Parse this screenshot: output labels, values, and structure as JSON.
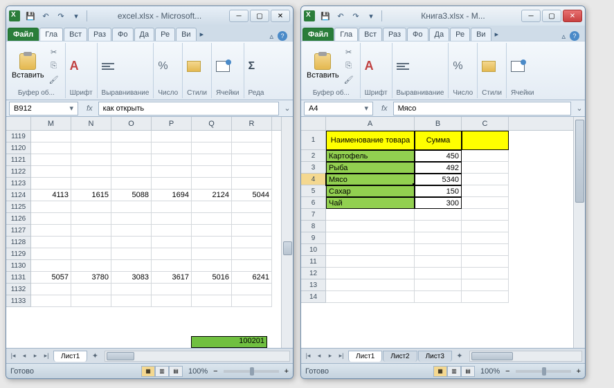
{
  "left": {
    "title": "excel.xlsx - Microsoft...",
    "tabs": {
      "file": "Файл",
      "home": "Гла",
      "insert": "Вст",
      "layout": "Раз",
      "formulas": "Фо",
      "data": "Да",
      "review": "Ре",
      "view": "Ви"
    },
    "ribbon": {
      "paste": "Вставить",
      "clipboard": "Буфер об...",
      "font": "Шрифт",
      "align": "Выравнивание",
      "number": "Число",
      "styles": "Стили",
      "cells": "Ячейки",
      "edit": "Реда"
    },
    "namebox": "B912",
    "formula": "как открыть",
    "cols": [
      "M",
      "N",
      "O",
      "P",
      "Q",
      "R"
    ],
    "rows": [
      "1119",
      "1120",
      "1121",
      "1122",
      "1123",
      "1124",
      "1125",
      "1126",
      "1127",
      "1128",
      "1129",
      "1130",
      "1131",
      "1132",
      "1133"
    ],
    "data_1124": [
      "4113",
      "1615",
      "5088",
      "1694",
      "2124",
      "5044"
    ],
    "data_1131": [
      "5057",
      "3780",
      "3083",
      "3617",
      "5016",
      "6241"
    ],
    "green_hint": "100201",
    "sheet": "Лист1",
    "status": "Готово",
    "zoom": "100%"
  },
  "right": {
    "title": "Книга3.xlsx - M...",
    "tabs": {
      "file": "Файл",
      "home": "Гла",
      "insert": "Вст",
      "layout": "Раз",
      "formulas": "Фо",
      "data": "Да",
      "review": "Ре",
      "view": "Ви"
    },
    "ribbon": {
      "paste": "Вставить",
      "clipboard": "Буфер об...",
      "font": "Шрифт",
      "align": "Выравнивание",
      "number": "Число",
      "styles": "Стили",
      "cells": "Ячейки"
    },
    "namebox": "A4",
    "formula": "Мясо",
    "cols": [
      "A",
      "B",
      "C"
    ],
    "rownums": [
      "1",
      "2",
      "3",
      "4",
      "5",
      "6",
      "7",
      "8",
      "9",
      "10",
      "11",
      "12",
      "13",
      "14"
    ],
    "header_a": "Наименование товара",
    "header_b": "Сумма",
    "rows": [
      {
        "a": "Картофель",
        "b": "450"
      },
      {
        "a": "Рыба",
        "b": "492"
      },
      {
        "a": "Мясо",
        "b": "5340"
      },
      {
        "a": "Сахар",
        "b": "150"
      },
      {
        "a": "Чай",
        "b": "300"
      }
    ],
    "sheets": [
      "Лист1",
      "Лист2",
      "Лист3"
    ],
    "status": "Готово",
    "zoom": "100%"
  },
  "chart_data": {
    "type": "table",
    "title": "Книга3.xlsx",
    "columns": [
      "Наименование товара",
      "Сумма"
    ],
    "rows": [
      [
        "Картофель",
        450
      ],
      [
        "Рыба",
        492
      ],
      [
        "Мясо",
        5340
      ],
      [
        "Сахар",
        150
      ],
      [
        "Чай",
        300
      ]
    ]
  }
}
